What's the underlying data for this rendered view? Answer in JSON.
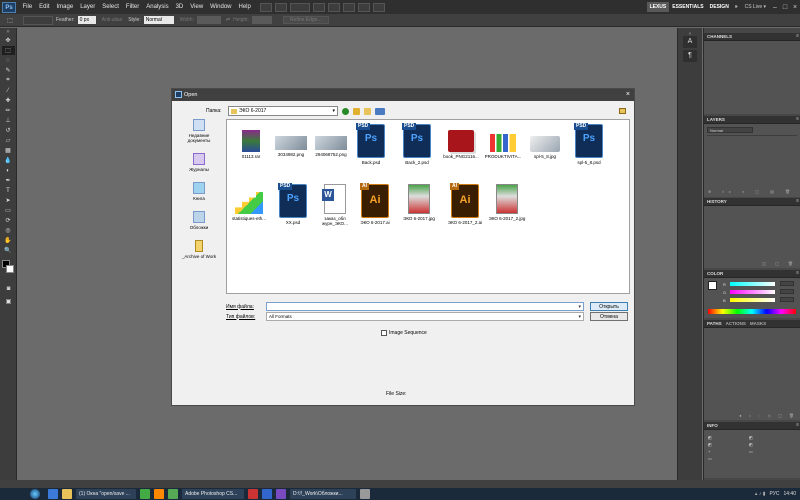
{
  "menubar": {
    "logo": "Ps",
    "items": [
      "File",
      "Edit",
      "Image",
      "Layer",
      "Select",
      "Filter",
      "Analysis",
      "3D",
      "View",
      "Window",
      "Help"
    ],
    "workspaces": [
      "LEXUS",
      "ESSENTIALS",
      "DESIGN"
    ],
    "more": "»",
    "cs_live": "CS Live ▾",
    "window_controls": [
      "–",
      "□",
      "×"
    ]
  },
  "options": {
    "feather_label": "Feather:",
    "feather_value": "0 px",
    "antialias_label": "Anti-alias",
    "style_label": "Style:",
    "style_value": "Normal",
    "width_label": "Width:",
    "height_label": "Height:",
    "refine_label": "Refine Edge..."
  },
  "panels": {
    "channels": "CHANNELS",
    "layers": "LAYERS",
    "layers_mode": "Normal",
    "history": "HISTORY",
    "color": "COLOR",
    "color_channels": [
      "R",
      "G",
      "B"
    ],
    "color_channel_values": [
      "",
      "",
      ""
    ],
    "paths_tabs": [
      "PATHS",
      "ACTIONS",
      "MASKS"
    ],
    "info": "INFO"
  },
  "dialog": {
    "title": "Open",
    "close": "×",
    "folder_label": "Папка:",
    "folder_value": "ЭКО 6-2017",
    "places": [
      "Недавние документы",
      "Журналы",
      "Книга",
      "Обложки",
      "_Archive of Work"
    ],
    "files": [
      {
        "name": "01113.rar",
        "type": "rar"
      },
      {
        "name": "3034982.png",
        "type": "img"
      },
      {
        "name": "294068752.png",
        "type": "img"
      },
      {
        "name": "Back.psd",
        "type": "psd",
        "badge": "PSD",
        "glyph": "Ps"
      },
      {
        "name": "Back_2.psd",
        "type": "psd",
        "badge": "PSD",
        "glyph": "Ps"
      },
      {
        "name": "book_PNG2116...",
        "type": "book"
      },
      {
        "name": "PRODUKTIVITA...",
        "type": "chart"
      },
      {
        "name": "spl-5_8.jpg",
        "type": "cubes"
      },
      {
        "name": "spl-5_8.psd",
        "type": "psd",
        "badge": "PSD",
        "glyph": "Ps"
      },
      {
        "name": "statistiques-eth...",
        "type": "stairs"
      },
      {
        "name": "XX.psd",
        "type": "psd",
        "badge": "PSD",
        "glyph": "Ps"
      },
      {
        "name": "заказ_обл журн_ЭКО...",
        "type": "doc",
        "glyph": "W"
      },
      {
        "name": "ЭКО 6-2017.ai",
        "type": "ai",
        "badge": "AI",
        "glyph": "Ai"
      },
      {
        "name": "ЭКО 6-2017.jpg",
        "type": "mag"
      },
      {
        "name": "ЭКО 6-2017_2.ai",
        "type": "ai",
        "badge": "AI",
        "glyph": "Ai"
      },
      {
        "name": "ЭКО 6-2017_2.jpg",
        "type": "mag"
      }
    ],
    "filename_label": "Имя файла:",
    "filename_value": "",
    "filetype_label": "Тип файлов:",
    "filetype_value": "All Formats",
    "open_label": "Открыть",
    "cancel_label": "Отмена",
    "image_sequence_label": "Image Sequence",
    "file_size_label": "File Size:"
  },
  "taskbar": {
    "tasks": [
      "(1) Окна \"open/save ...",
      "Adobe Photoshop CS...",
      "D:\\!!_Work\\Обложки..."
    ],
    "language": "РУС",
    "time": "14:40"
  }
}
